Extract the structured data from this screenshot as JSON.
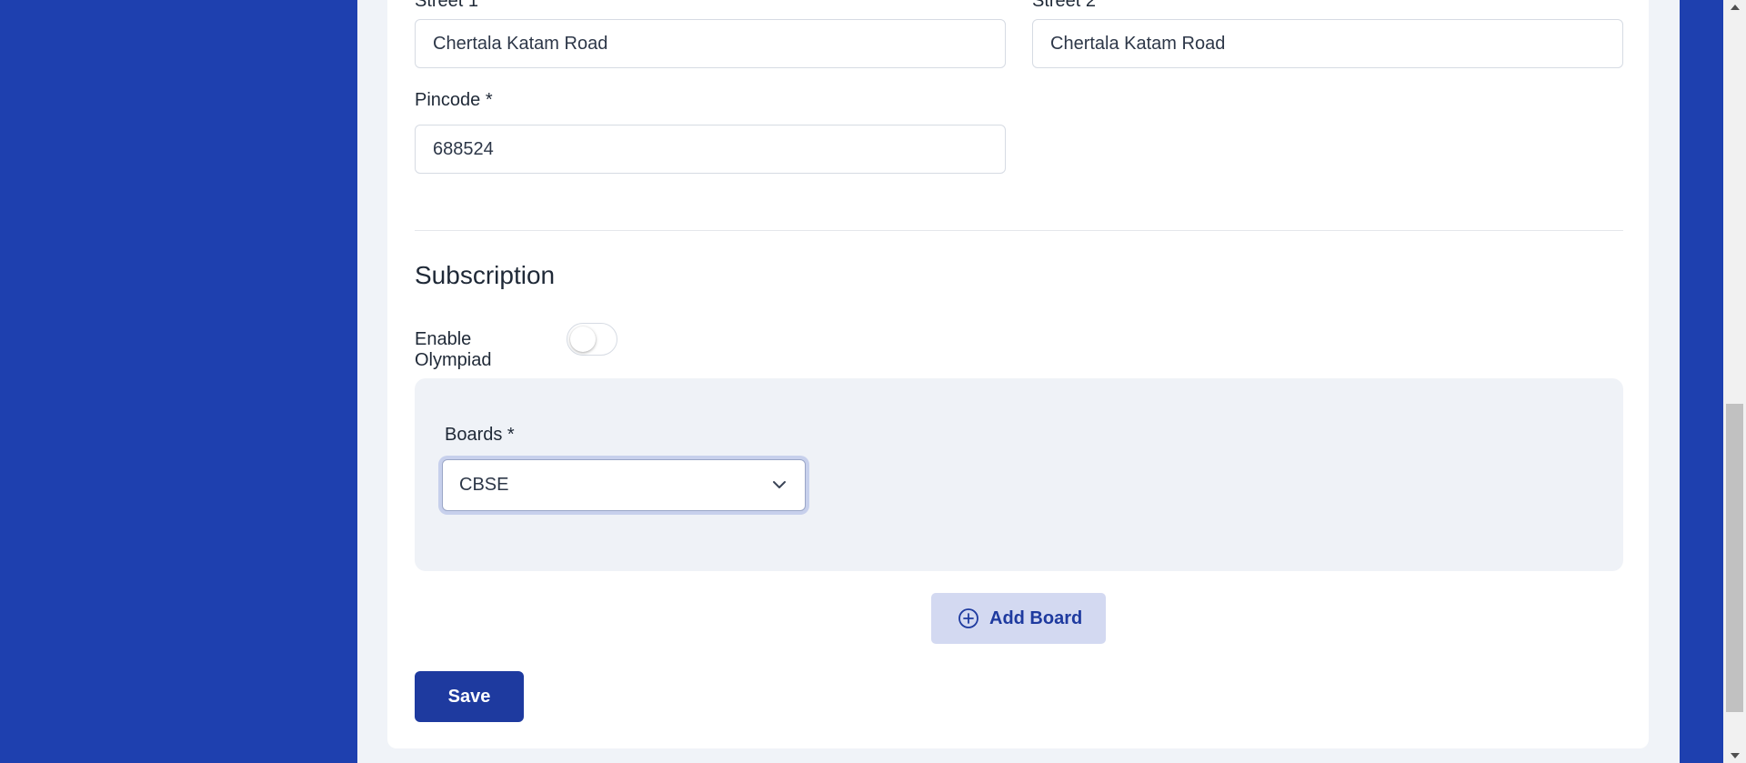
{
  "address": {
    "street1_label": "Street 1",
    "street1_value": "Chertala Katam Road",
    "street2_label": "Street 2",
    "street2_value": "Chertala Katam Road",
    "pincode_label": "Pincode *",
    "pincode_value": "688524"
  },
  "subscription": {
    "title": "Subscription",
    "olympiad_label": "Enable Olympiad",
    "olympiad_enabled": false,
    "boards_label": "Boards *",
    "boards_selected": "CBSE",
    "add_board_label": "Add Board"
  },
  "actions": {
    "save_label": "Save"
  },
  "icons": {
    "select_arrow": "chevron-down-icon",
    "add_board": "plus-circle-icon"
  },
  "colors": {
    "brand": "#1e40af",
    "primary_button": "#1e3a9f",
    "secondary_button_bg": "#d3d9f1",
    "page_bg": "#f0f3f8",
    "panel_bg": "#eff2f7"
  }
}
